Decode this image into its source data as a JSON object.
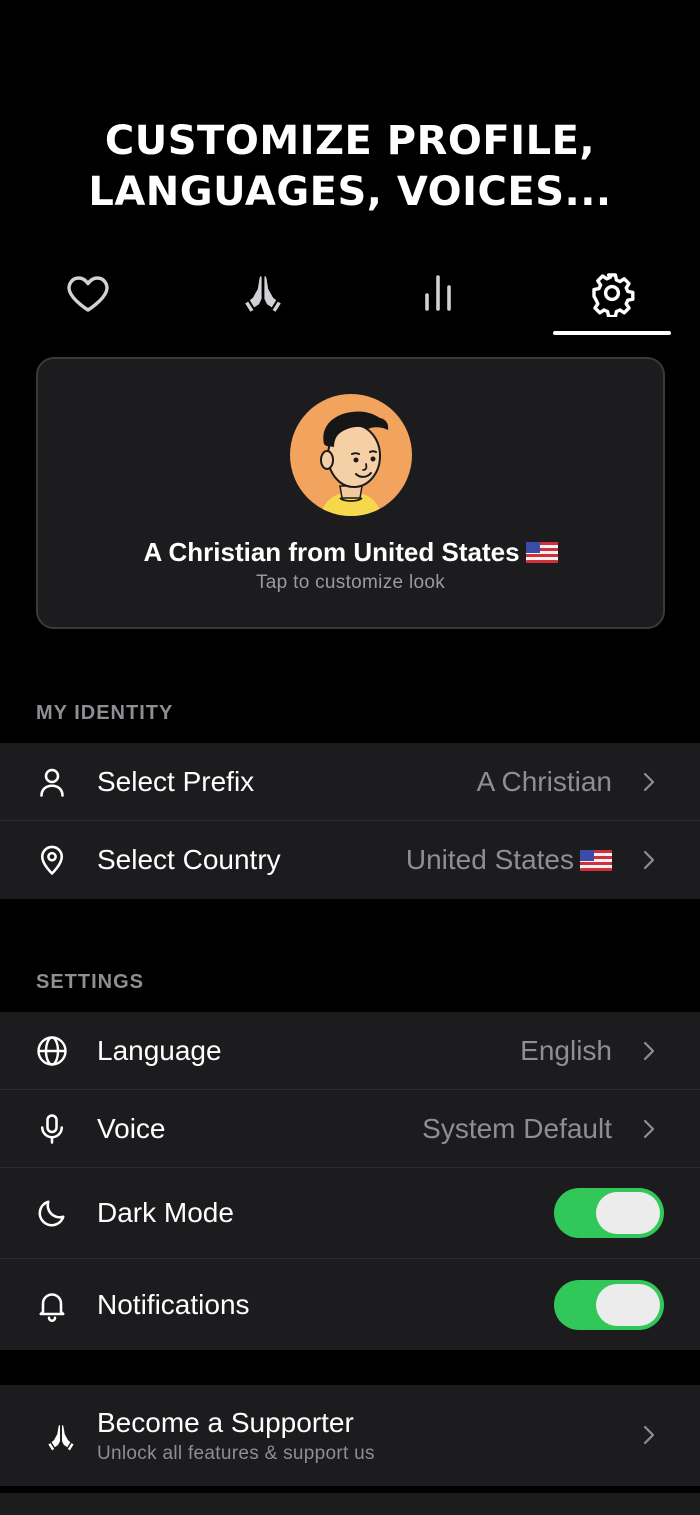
{
  "headline": {
    "line1": "CUSTOMIZE PROFILE,",
    "line2": "LANGUAGES, VOICES..."
  },
  "tabs": [
    {
      "icon": "heart-icon",
      "active": false
    },
    {
      "icon": "praying-hands-icon",
      "active": false
    },
    {
      "icon": "stats-bars-icon",
      "active": false
    },
    {
      "icon": "gear-icon",
      "active": true
    }
  ],
  "profile": {
    "name": "A Christian from United States",
    "subtitle": "Tap to customize look"
  },
  "identity": {
    "section_label": "MY IDENTITY",
    "prefix": {
      "label": "Select Prefix",
      "value": "A Christian"
    },
    "country": {
      "label": "Select Country",
      "value": "United States"
    }
  },
  "settings": {
    "section_label": "SETTINGS",
    "language": {
      "label": "Language",
      "value": "English"
    },
    "voice": {
      "label": "Voice",
      "value": "System Default"
    },
    "dark_mode": {
      "label": "Dark Mode",
      "on": true
    },
    "notifications": {
      "label": "Notifications",
      "on": true
    }
  },
  "supporter": {
    "title": "Become a Supporter",
    "subtitle": "Unlock all features & support us"
  },
  "colors": {
    "background": "#000000",
    "card": "#1c1c1e",
    "secondary_text": "#8e8e93",
    "toggle_on": "#32c759"
  }
}
